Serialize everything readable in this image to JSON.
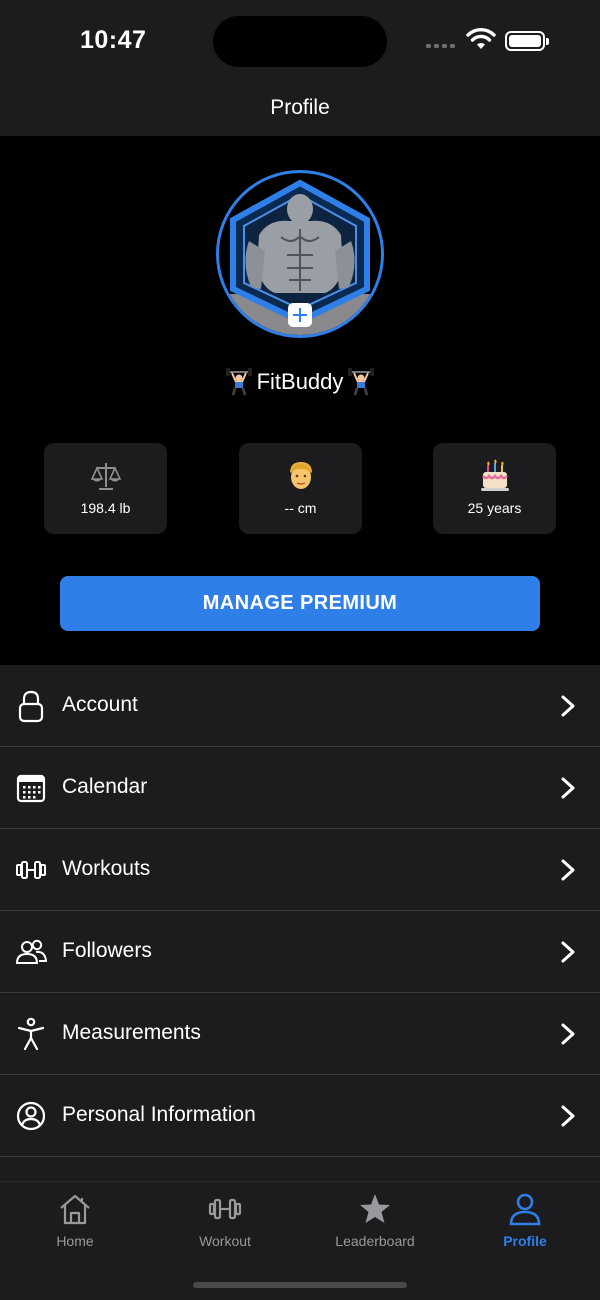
{
  "status_bar": {
    "time": "10:47"
  },
  "header": {
    "title": "Profile"
  },
  "profile": {
    "username": "FitBuddy",
    "stats": [
      {
        "icon": "balance-scale-icon",
        "value": "198.4 lb"
      },
      {
        "icon": "person-face-icon",
        "value": "-- cm"
      },
      {
        "icon": "birthday-cake-icon",
        "value": "25 years"
      }
    ],
    "premium_button": "MANAGE PREMIUM"
  },
  "menu": [
    {
      "label": "Account",
      "icon": "lock-icon"
    },
    {
      "label": "Calendar",
      "icon": "calendar-icon"
    },
    {
      "label": "Workouts",
      "icon": "dumbbell-icon"
    },
    {
      "label": "Followers",
      "icon": "people-icon"
    },
    {
      "label": "Measurements",
      "icon": "body-icon"
    },
    {
      "label": "Personal Information",
      "icon": "person-circle-icon"
    }
  ],
  "tabbar": {
    "tabs": [
      {
        "label": "Home",
        "icon": "house-icon"
      },
      {
        "label": "Workout",
        "icon": "dumbbell-icon"
      },
      {
        "label": "Leaderboard",
        "icon": "star-icon"
      },
      {
        "label": "Profile",
        "icon": "person-icon"
      }
    ],
    "active_tab": "Profile"
  },
  "colors": {
    "accent": "#2f7fe8",
    "background": "#000000",
    "surface": "#1c1c1e",
    "divider": "#3a3a3c",
    "inactive": "#98989d"
  }
}
